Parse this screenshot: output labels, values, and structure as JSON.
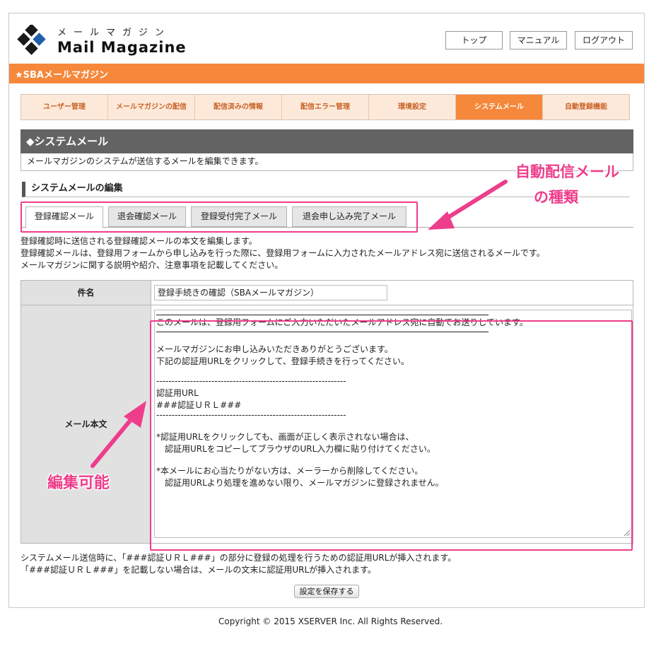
{
  "header": {
    "logo_kana": "メールマガジン",
    "logo_title": "Mail Magazine",
    "buttons": {
      "top": "トップ",
      "manual": "マニュアル",
      "logout": "ログアウト"
    }
  },
  "site_bar": {
    "title": "★SBAメールマガジン"
  },
  "nav": {
    "items": [
      {
        "label": "ユーザー管理"
      },
      {
        "label": "メールマガジンの配信"
      },
      {
        "label": "配信済みの情報"
      },
      {
        "label": "配信エラー管理"
      },
      {
        "label": "環境設定"
      },
      {
        "label": "システムメール"
      },
      {
        "label": "自動登録機能"
      }
    ],
    "active_index": 5
  },
  "section": {
    "title": "◆システムメール",
    "description": "メールマガジンのシステムが送信するメールを編集できます。"
  },
  "edit": {
    "heading": "システムメールの編集",
    "tabs": [
      {
        "label": "登録確認メール"
      },
      {
        "label": "退会確認メール"
      },
      {
        "label": "登録受付完了メール"
      },
      {
        "label": "退会申し込み完了メール"
      }
    ],
    "active_tab": 0,
    "info": [
      "登録確認時に送信される登録確認メールの本文を編集します。",
      "登録確認メールは、登録用フォームから申し込みを行った際に、登録用フォームに入力されたメールアドレス宛に送信されるメールです。",
      "メールマガジンに関する説明や紹介、注意事項を記載してください。"
    ]
  },
  "form": {
    "subject_label": "件名",
    "subject_value": "登録手続きの確認（SBAメールマガジン）",
    "body_label": "メール本文",
    "body_lines": {
      "l1": "このメールは、登録用フォームにご入力いただいたメールアドレス宛に自動でお送りしています。",
      "l2": "メールマガジンにお申し込みいただきありがとうございます。",
      "l3": "下記の認証用URLをクリックして、登録手続きを行ってください。",
      "dash1": "--------------------------------------------------------------",
      "l4": "認証用URL",
      "l5": "###認証ＵＲＬ###",
      "dash2": "--------------------------------------------------------------",
      "l6": "*認証用URLをクリックしても、画面が正しく表示されない場合は、",
      "l7": "　認証用URLをコピーしてブラウザのURL入力欄に貼り付けてください。",
      "l8": "*本メールにお心当たりがない方は、メーラーから削除してください。",
      "l9": "　認証用URLより処理を進めない限り、メールマガジンに登録されません。"
    }
  },
  "notes": [
    "システムメール送信時に、「###認証ＵＲＬ###」の部分に登録の処理を行うための認証用URLが挿入されます。",
    "「###認証ＵＲＬ###」を記載しない場合は、メールの文末に認証用URLが挿入されます。"
  ],
  "save_button": "設定を保存する",
  "copyright": "Copyright © 2015 XSERVER Inc. All Rights Reserved.",
  "annotations": {
    "tabs_note_line1": "自動配信メール",
    "tabs_note_line2": "の種類",
    "body_note": "編集可能",
    "color": "#ee3d8b"
  },
  "colors": {
    "accent": "#f6883b",
    "section_header": "#636363",
    "nav_bg": "#fde9da"
  }
}
